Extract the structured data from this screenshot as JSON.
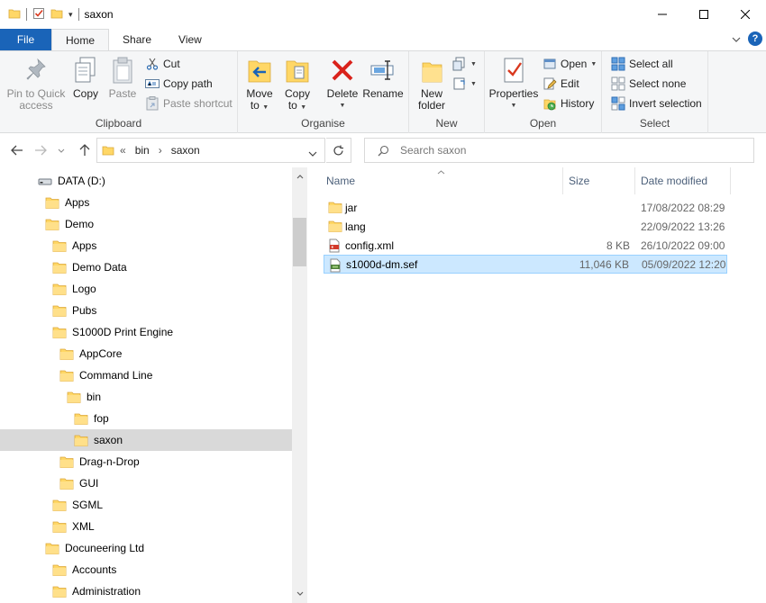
{
  "window": {
    "title": "saxon",
    "minimize_glyph": "—",
    "maximize_glyph": "☐",
    "close_glyph": "✕"
  },
  "tabs": {
    "file": "File",
    "home": "Home",
    "share": "Share",
    "view": "View",
    "expand_glyph": "⌄",
    "help_glyph": "?"
  },
  "ribbon": {
    "clipboard": {
      "label": "Clipboard",
      "pin_line1": "Pin to Quick",
      "pin_line2": "access",
      "copy": "Copy",
      "paste": "Paste",
      "cut": "Cut",
      "copy_path": "Copy path",
      "paste_shortcut": "Paste shortcut"
    },
    "organise": {
      "label": "Organise",
      "move_line1": "Move",
      "move_line2": "to",
      "copy_line1": "Copy",
      "copy_line2": "to",
      "delete": "Delete",
      "rename": "Rename"
    },
    "new": {
      "label": "New",
      "folder_line1": "New",
      "folder_line2": "folder"
    },
    "open": {
      "label": "Open",
      "properties": "Properties",
      "open": "Open",
      "edit": "Edit",
      "history": "History"
    },
    "select": {
      "label": "Select",
      "select_all": "Select all",
      "select_none": "Select none",
      "invert": "Invert selection"
    }
  },
  "address": {
    "chevrons": "«",
    "crumbs": [
      "bin",
      "saxon"
    ],
    "separator": "›",
    "search_placeholder": "Search saxon"
  },
  "tree": [
    {
      "label": "DATA (D:)",
      "indent": 0,
      "icon": "drive-icon"
    },
    {
      "label": "Apps",
      "indent": 1,
      "icon": "folder-icon"
    },
    {
      "label": "Demo",
      "indent": 1,
      "icon": "folder-icon"
    },
    {
      "label": "Apps",
      "indent": 2,
      "icon": "folder-icon"
    },
    {
      "label": "Demo Data",
      "indent": 2,
      "icon": "folder-icon"
    },
    {
      "label": "Logo",
      "indent": 2,
      "icon": "folder-icon"
    },
    {
      "label": "Pubs",
      "indent": 2,
      "icon": "folder-icon"
    },
    {
      "label": "S1000D Print Engine",
      "indent": 2,
      "icon": "folder-icon"
    },
    {
      "label": "AppCore",
      "indent": 3,
      "icon": "folder-icon"
    },
    {
      "label": "Command Line",
      "indent": 3,
      "icon": "folder-icon"
    },
    {
      "label": "bin",
      "indent": 4,
      "icon": "folder-icon"
    },
    {
      "label": "fop",
      "indent": 5,
      "icon": "folder-icon"
    },
    {
      "label": "saxon",
      "indent": 5,
      "icon": "folder-icon",
      "selected": true
    },
    {
      "label": "Drag-n-Drop",
      "indent": 3,
      "icon": "folder-icon"
    },
    {
      "label": "GUI",
      "indent": 3,
      "icon": "folder-icon"
    },
    {
      "label": "SGML",
      "indent": 2,
      "icon": "folder-icon"
    },
    {
      "label": "XML",
      "indent": 2,
      "icon": "folder-icon"
    },
    {
      "label": "Docuneering Ltd",
      "indent": 1,
      "icon": "folder-icon"
    },
    {
      "label": "Accounts",
      "indent": 2,
      "icon": "folder-icon"
    },
    {
      "label": "Administration",
      "indent": 2,
      "icon": "folder-icon"
    }
  ],
  "columns": {
    "name": "Name",
    "size": "Size",
    "date": "Date modified"
  },
  "files": [
    {
      "name": "jar",
      "size": "",
      "date": "17/08/2022 08:29",
      "icon": "folder-icon"
    },
    {
      "name": "lang",
      "size": "",
      "date": "22/09/2022 13:26",
      "icon": "folder-icon"
    },
    {
      "name": "config.xml",
      "size": "8 KB",
      "date": "26/10/2022 09:00",
      "icon": "xml-file-icon"
    },
    {
      "name": "s1000d-dm.sef",
      "size": "11,046 KB",
      "date": "05/09/2022 12:20",
      "icon": "sef-file-icon",
      "selected": true
    }
  ],
  "colors": {
    "accent": "#1a64b8",
    "folder": "#ffd766",
    "selection": "#cce8ff",
    "tree_selection": "#d9d9d9"
  }
}
